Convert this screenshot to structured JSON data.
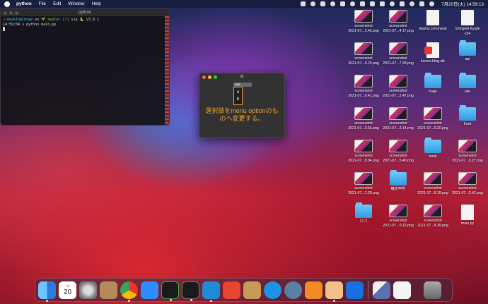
{
  "menubar": {
    "app_name": "python",
    "items": [
      "File",
      "Edit",
      "Window",
      "Help"
    ],
    "clock": "7月20日(火) 14:59:13"
  },
  "terminal": {
    "title": "python",
    "line1_path": "~/desktop/hoge",
    "line1_on": "on",
    "line1_branch": "🌱 master [!]",
    "line1_via": "via 🐍 v3.9.1",
    "line2_time": "14:59:04",
    "line2_cmd": "❯ python main.py"
  },
  "tk": {
    "title": "tk",
    "menubutton_label": "aaa",
    "options": [
      "A",
      "B"
    ],
    "label_text": "選択肢をmenu optionのものへ変更する。"
  },
  "desktop": {
    "icons": [
      {
        "kind": "thumb",
        "label1": "screenshot",
        "label2": "2021-07...3.46.png"
      },
      {
        "kind": "thumb",
        "label1": "screenshot",
        "label2": "2021-07...4.17.png"
      },
      {
        "kind": "doc",
        "label1": "deploy.command",
        "label2": ""
      },
      {
        "kind": "doc",
        "label1": "Shingeki Kyojin",
        "label2": "v34"
      },
      {
        "kind": "thumb",
        "label1": "screenshot",
        "label2": "2021-07...9.29.png"
      },
      {
        "kind": "thumb",
        "label1": "screenshot",
        "label2": "2021-07...7.28.png"
      },
      {
        "kind": "docred",
        "label1": "kuroro.blog.stk",
        "label2": ""
      },
      {
        "kind": "folder",
        "label1": "api",
        "label2": ""
      },
      {
        "kind": "thumb",
        "label1": "screenshot",
        "label2": "2021-07...0.41.png"
      },
      {
        "kind": "thumb",
        "label1": "screenshot",
        "label2": "2021-07...2.47.png"
      },
      {
        "kind": "folder",
        "label1": "hoge",
        "label2": ""
      },
      {
        "kind": "folder",
        "label1": "site",
        "label2": ""
      },
      {
        "kind": "thumb",
        "label1": "screenshot",
        "label2": "2021-07...3.56.png"
      },
      {
        "kind": "thumb",
        "label1": "screenshot",
        "label2": "2021-07...3.14.png"
      },
      {
        "kind": "thumb",
        "label1": "screenshot",
        "label2": "2021-07...9.20.png"
      },
      {
        "kind": "folder",
        "label1": "front",
        "label2": ""
      },
      {
        "kind": "thumb",
        "label1": "screenshot",
        "label2": "2021-07...9.04.png"
      },
      {
        "kind": "thumb",
        "label1": "screenshot",
        "label2": "2021-07...5.40.png"
      },
      {
        "kind": "folder",
        "label1": "tools",
        "label2": ""
      },
      {
        "kind": "thumb",
        "label1": "screenshot",
        "label2": "2021-07...9.27.png"
      },
      {
        "kind": "thumb",
        "label1": "screenshot",
        "label2": "2021-07...1.28.png"
      },
      {
        "kind": "folder",
        "label1": "確定申告",
        "label2": ""
      },
      {
        "kind": "thumb",
        "label1": "screenshot",
        "label2": "2021-07...6.19.png"
      },
      {
        "kind": "thumb",
        "label1": "screenshot",
        "label2": "2021-07...3.42.png"
      },
      {
        "kind": "folder",
        "label1": "ロゴ",
        "label2": ""
      },
      {
        "kind": "thumb",
        "label1": "screenshot",
        "label2": "2021-07...0.13.png"
      },
      {
        "kind": "thumb",
        "label1": "screenshot",
        "label2": "2021-07...4.39.png"
      },
      {
        "kind": "doc",
        "label1": "main.py",
        "label2": ""
      }
    ]
  },
  "dock": {
    "calendar_day": "20",
    "calendar_month": "7月"
  },
  "colors": {
    "tk_accent": "#e8a030",
    "folder_blue": "#2d9de3"
  }
}
